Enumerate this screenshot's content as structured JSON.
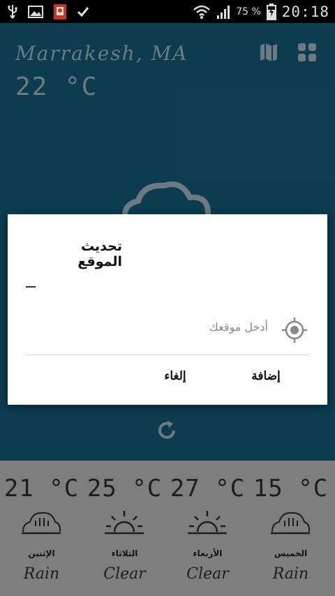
{
  "status_bar": {
    "battery_percent": "75 %",
    "time": "20:18",
    "icons": [
      "usb-icon",
      "image-icon",
      "app-notification-icon",
      "check-icon",
      "wifi-icon",
      "signal-icon",
      "battery-charging-icon"
    ]
  },
  "header": {
    "city": "Marrakesh, MA",
    "temperature": "22 °C",
    "icons": [
      "map-icon",
      "grid-icon"
    ]
  },
  "dialog": {
    "title": "تحديث الموقع",
    "input_placeholder": "أدخل موقعك",
    "cancel_label": "إلغاء",
    "add_label": "إضافة"
  },
  "forecast": [
    {
      "temp": "21 °C",
      "day": "الإثنين",
      "condition": "Rain",
      "icon": "rain-cloud-icon"
    },
    {
      "temp": "25 °C",
      "day": "الثلاثاء",
      "condition": "Clear",
      "icon": "sun-icon"
    },
    {
      "temp": "27 °C",
      "day": "الأربعاء",
      "condition": "Clear",
      "icon": "sun-icon"
    },
    {
      "temp": "15 °C",
      "day": "الخميس",
      "condition": "Rain",
      "icon": "rain-cloud-icon"
    }
  ],
  "colors": {
    "app_background": "#18678a",
    "forecast_background": "#d9d9d9",
    "dialog_background": "#ffffff"
  }
}
